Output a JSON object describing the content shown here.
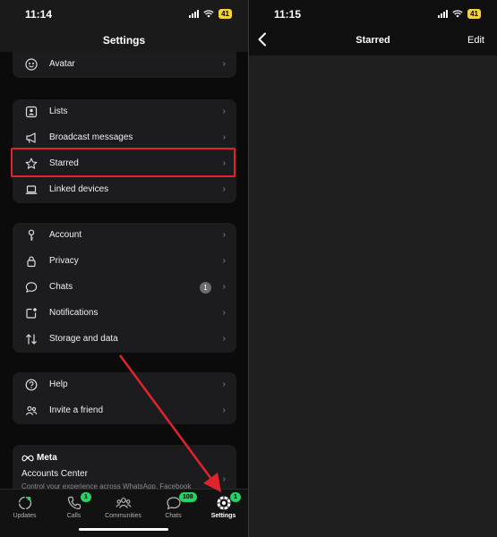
{
  "left": {
    "status": {
      "time": "11:14",
      "battery": "41"
    },
    "title": "Settings",
    "groups": [
      {
        "items": [
          {
            "label": "Avatar",
            "icon": "avatar-icon"
          }
        ]
      },
      {
        "items": [
          {
            "label": "Lists",
            "icon": "lists-icon"
          },
          {
            "label": "Broadcast messages",
            "icon": "megaphone-icon"
          },
          {
            "label": "Starred",
            "icon": "star-icon"
          },
          {
            "label": "Linked devices",
            "icon": "laptop-icon"
          }
        ]
      },
      {
        "items": [
          {
            "label": "Account",
            "icon": "key-icon"
          },
          {
            "label": "Privacy",
            "icon": "lock-icon"
          },
          {
            "label": "Chats",
            "icon": "chat-bubble-icon",
            "count": "1"
          },
          {
            "label": "Notifications",
            "icon": "notification-icon"
          },
          {
            "label": "Storage and data",
            "icon": "storage-arrows-icon"
          }
        ]
      },
      {
        "items": [
          {
            "label": "Help",
            "icon": "help-icon"
          },
          {
            "label": "Invite a friend",
            "icon": "people-icon"
          }
        ]
      }
    ],
    "meta": {
      "brand": "Meta",
      "accounts_center": "Accounts Center",
      "description": "Control your experience across WhatsApp, Facebook"
    },
    "tabs": [
      {
        "label": "Updates",
        "icon": "updates-icon"
      },
      {
        "label": "Calls",
        "icon": "phone-icon",
        "badge": "1"
      },
      {
        "label": "Communities",
        "icon": "communities-icon"
      },
      {
        "label": "Chats",
        "icon": "chats-icon",
        "badge": "108"
      },
      {
        "label": "Settings",
        "icon": "settings-gear-icon",
        "badge": "1",
        "active": true
      }
    ]
  },
  "right": {
    "status": {
      "time": "11:15",
      "battery": "41"
    },
    "title": "Starred",
    "edit_label": "Edit"
  },
  "colors": {
    "highlight": "#e0242e",
    "whatsapp_green": "#25d366",
    "battery": "#f4d23c"
  }
}
